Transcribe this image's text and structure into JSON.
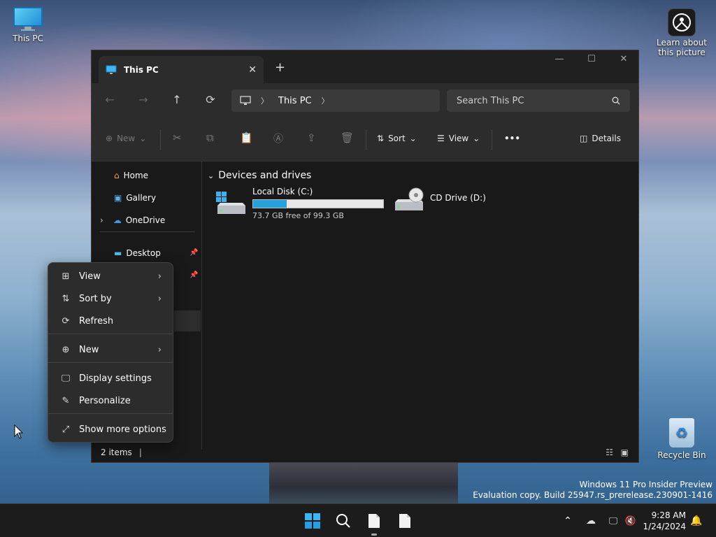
{
  "desktop": {
    "this_pc_label": "This PC",
    "learn_label": "Learn about this picture",
    "recycle_label": "Recycle Bin"
  },
  "watermark": {
    "line1": "Windows 11 Pro Insider Preview",
    "line2": "Evaluation copy. Build 25947.rs_prerelease.230901-1416"
  },
  "explorer": {
    "tab_title": "This PC",
    "address_location": "This PC",
    "search_placeholder": "Search This PC",
    "commands": {
      "new": "New",
      "sort": "Sort",
      "view": "View",
      "more": "•••",
      "details": "Details"
    },
    "nav": {
      "home": "Home",
      "gallery": "Gallery",
      "onedrive": "OneDrive",
      "desktop": "Desktop"
    },
    "group_header": "Devices and drives",
    "drives": [
      {
        "name": "Local Disk (C:)",
        "free_text": "73.7 GB free of 99.3 GB",
        "used_fraction": 0.258
      },
      {
        "name": "CD Drive (D:)"
      }
    ],
    "status": "2 items"
  },
  "context_menu": {
    "items": [
      {
        "label": "View",
        "icon": "grid-icon",
        "submenu": true
      },
      {
        "label": "Sort by",
        "icon": "sort-icon",
        "submenu": true
      },
      {
        "label": "Refresh",
        "icon": "refresh-icon",
        "submenu": false
      },
      {
        "label": "New",
        "icon": "plus-circle-icon",
        "submenu": true
      },
      {
        "label": "Display settings",
        "icon": "display-icon",
        "submenu": false
      },
      {
        "label": "Personalize",
        "icon": "brush-icon",
        "submenu": false
      },
      {
        "label": "Show more options",
        "icon": "expand-icon",
        "submenu": false
      }
    ]
  },
  "taskbar": {
    "time": "9:28 AM",
    "date": "1/24/2024"
  },
  "colors": {
    "accent": "#26a0da",
    "window_bg": "#191919",
    "toolbar_bg": "#2c2c2c"
  }
}
